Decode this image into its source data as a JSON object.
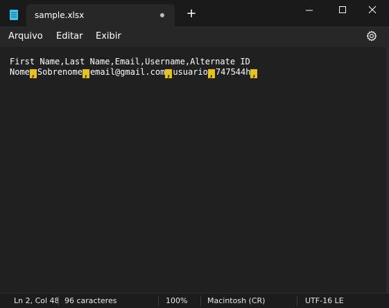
{
  "titlebar": {
    "tab_title": "sample.xlsx",
    "new_tab_symbol": "+",
    "unsaved": true
  },
  "menu": {
    "file": "Arquivo",
    "edit": "Editar",
    "view": "Exibir"
  },
  "editor": {
    "line1": "First Name,Last Name,Email,Username,Alternate ID",
    "line2_fields": [
      "Nome",
      "Sobrenome",
      "email@gmail.com",
      "usuario",
      "747544h"
    ],
    "separator_marker": ",",
    "highlight_color": "#e6c21f"
  },
  "status": {
    "position": "Ln 2, Col 48",
    "characters": "96 caracteres",
    "zoom": "100%",
    "line_ending": "Macintosh (CR)",
    "encoding": "UTF-16 LE"
  },
  "colors": {
    "background": "#202020",
    "titlebar": "#1a1a1a",
    "app_icon": "#3ec4e8"
  }
}
